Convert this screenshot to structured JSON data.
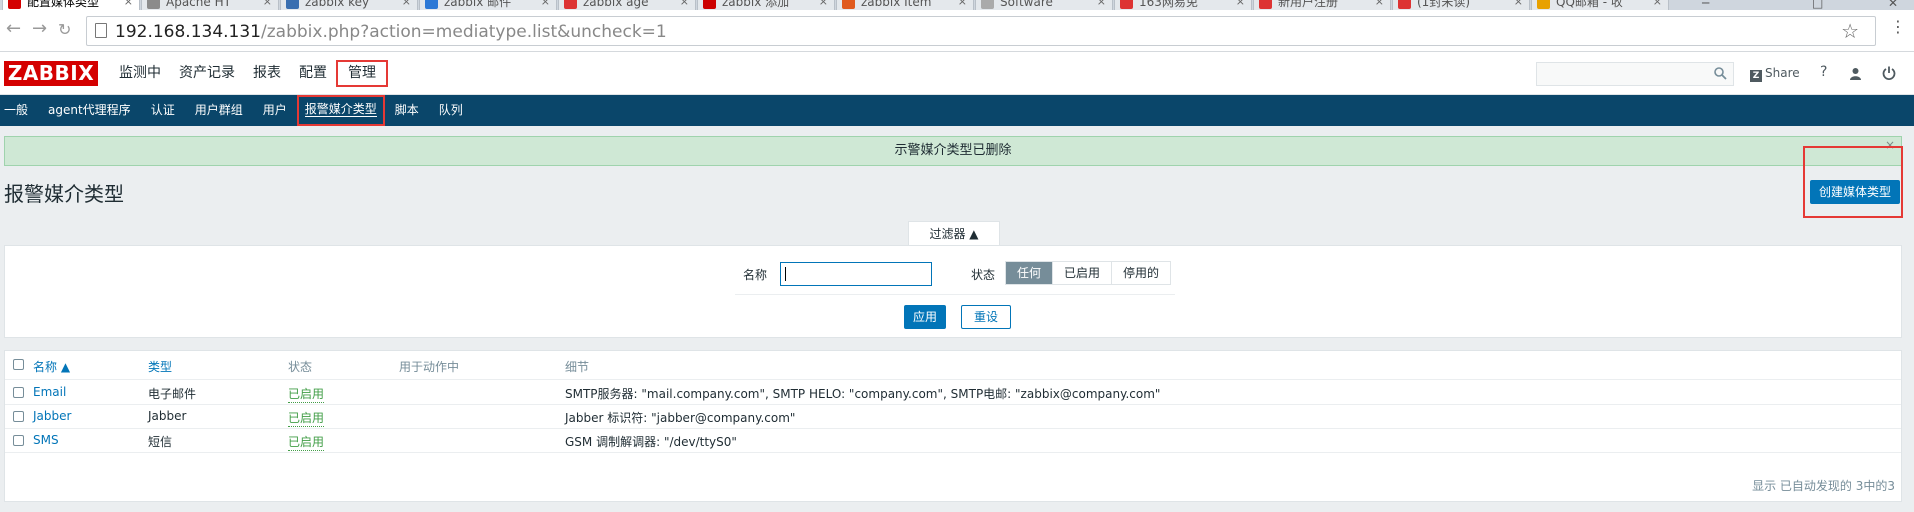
{
  "browser": {
    "tabs": [
      {
        "title": "配置媒体类型",
        "favicon_color": "#d40000",
        "active": true
      },
      {
        "title": "Apache HT",
        "favicon_color": "#8b8b8b",
        "active": false
      },
      {
        "title": "zabbix key",
        "favicon_color": "#3a6fb0",
        "active": false
      },
      {
        "title": "zabbix 邮件",
        "favicon_color": "#2d79d6",
        "active": false
      },
      {
        "title": "zabbix age",
        "favicon_color": "#d33",
        "active": false
      },
      {
        "title": "zabbix 添加",
        "favicon_color": "#c00",
        "active": false
      },
      {
        "title": "zabbix Item",
        "favicon_color": "#e05a1e",
        "active": false
      },
      {
        "title": "Software",
        "favicon_color": "#aaa",
        "active": false
      },
      {
        "title": "163网易免",
        "favicon_color": "#d33",
        "active": false
      },
      {
        "title": "新用户注册",
        "favicon_color": "#d33",
        "active": false
      },
      {
        "title": "(1封未读)",
        "favicon_color": "#d33",
        "active": false
      },
      {
        "title": "QQ邮箱 - 收",
        "favicon_color": "#e8a100",
        "active": false
      }
    ],
    "url_host": "192.168.134.131",
    "url_path": "/zabbix.php?action=mediatype.list&uncheck=1"
  },
  "header": {
    "logo": "ZABBIX",
    "menu": [
      {
        "label": "监测中",
        "active": false
      },
      {
        "label": "资产记录",
        "active": false
      },
      {
        "label": "报表",
        "active": false
      },
      {
        "label": "配置",
        "active": false
      },
      {
        "label": "管理",
        "active": true
      }
    ],
    "share": "Share",
    "help": "?"
  },
  "subnav": {
    "items": [
      {
        "label": "一般",
        "active": false
      },
      {
        "label": "agent代理程序",
        "active": false
      },
      {
        "label": "认证",
        "active": false
      },
      {
        "label": "用户群组",
        "active": false
      },
      {
        "label": "用户",
        "active": false
      },
      {
        "label": "报警媒介类型",
        "active": true
      },
      {
        "label": "脚本",
        "active": false
      },
      {
        "label": "队列",
        "active": false
      }
    ]
  },
  "message": {
    "text": "示警媒介类型已删除",
    "close": "×"
  },
  "page": {
    "title": "报警媒介类型",
    "create_button": "创建媒体类型"
  },
  "filter": {
    "tab_label": "过滤器 ▲",
    "name_label": "名称",
    "name_value": "",
    "status_label": "状态",
    "status_options": [
      {
        "label": "任何",
        "selected": true
      },
      {
        "label": "已启用",
        "selected": false
      },
      {
        "label": "停用的",
        "selected": false
      }
    ],
    "apply": "应用",
    "reset": "重设"
  },
  "table": {
    "columns": {
      "name": "名称 ▲",
      "type": "类型",
      "status": "状态",
      "used_in_actions": "用于动作中",
      "details": "细节"
    },
    "rows": [
      {
        "name": "Email",
        "type": "电子邮件",
        "status": "已启用",
        "used_in_actions": "",
        "details": "SMTP服务器: \"mail.company.com\", SMTP HELO: \"company.com\", SMTP电邮: \"zabbix@company.com\""
      },
      {
        "name": "Jabber",
        "type": "Jabber",
        "status": "已启用",
        "used_in_actions": "",
        "details": "Jabber 标识符: \"jabber@company.com\""
      },
      {
        "name": "SMS",
        "type": "短信",
        "status": "已启用",
        "used_in_actions": "",
        "details": "GSM 调制解调器: \"/dev/ttyS0\""
      }
    ],
    "footer": "显示 已自动发现的 3中的3"
  },
  "colors": {
    "accent": "#0275b8",
    "nav_bg": "#0a466a",
    "logo_bg": "#d40000",
    "enabled": "#429e47",
    "highlight_box": "#e53935"
  }
}
